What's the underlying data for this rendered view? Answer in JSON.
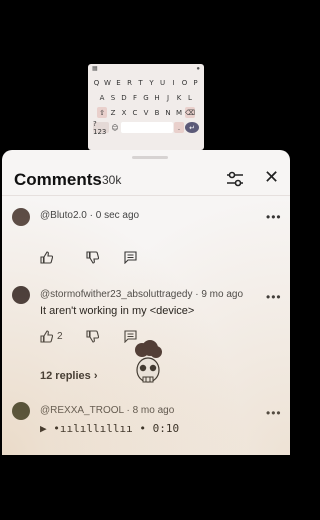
{
  "keyboard": {
    "row1": [
      "Q",
      "W",
      "E",
      "R",
      "T",
      "Y",
      "U",
      "I",
      "O",
      "P"
    ],
    "row2": [
      "A",
      "S",
      "D",
      "F",
      "G",
      "H",
      "J",
      "K",
      "L"
    ],
    "row3": [
      "⇧",
      "Z",
      "X",
      "C",
      "V",
      "B",
      "N",
      "M",
      "⌫"
    ],
    "row4": [
      "?123",
      "☺",
      "",
      ".",
      "↵"
    ]
  },
  "header": {
    "title": "Comments",
    "count": "30k"
  },
  "comments": [
    {
      "user": "@Bluto2.0 · 0 sec ago",
      "text": "",
      "likes": ""
    },
    {
      "user": "@stormofwither23_absoluttragedy · 9 mo ago",
      "text": "It aren't working in my <device>",
      "likes": "2",
      "replies": "12 replies"
    },
    {
      "user": "@REXXA_TROOL · 8 mo ago",
      "text": "▶ •ıılıllıllıı • 0:10",
      "likes": ""
    }
  ]
}
